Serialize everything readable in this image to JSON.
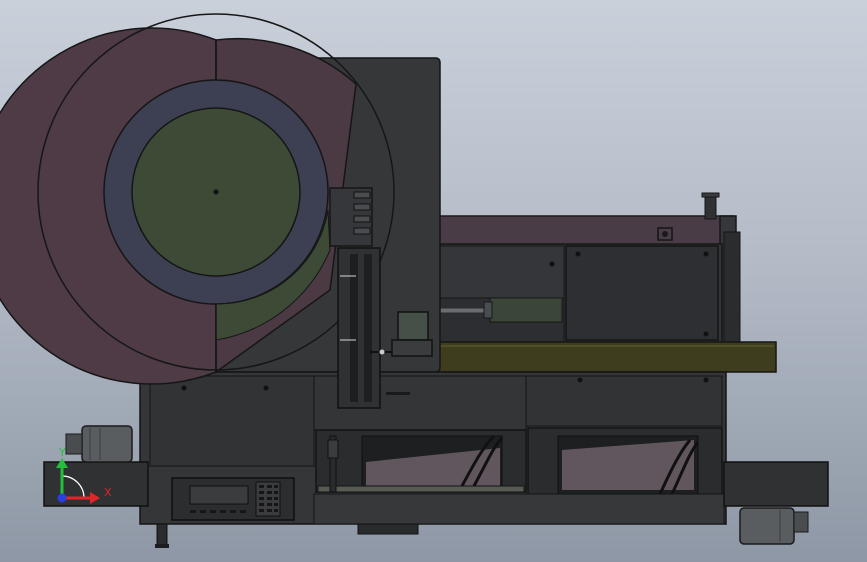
{
  "viewport": {
    "background_top": "#c9d0da",
    "background_bottom": "#8e97a5"
  },
  "triad": {
    "x_label": "X",
    "y_label": "Y",
    "x_color": "#e0262b",
    "y_color": "#22c03a",
    "z_color": "#2a3fe0"
  },
  "model": {
    "body_color": "#3a3d40",
    "disc_color": "#4e3b45",
    "ring_color": "#3d3f52",
    "hub_color": "#3c4a36",
    "rail_color": "#3e3e1f"
  }
}
